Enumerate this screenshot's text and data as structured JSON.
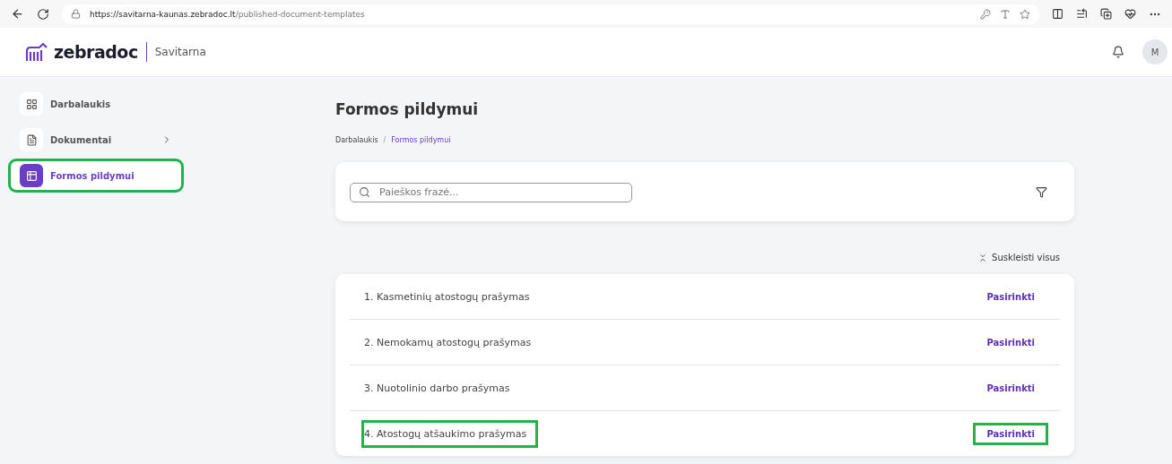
{
  "browser": {
    "url_host": "https://savitarna-kaunas.zebradoc.lt",
    "url_path": "/published-document-templates"
  },
  "header": {
    "brand": "zebradoc",
    "product": "Savitarna",
    "avatar": "M"
  },
  "sidebar": {
    "items": [
      {
        "label": "Darbalaukis",
        "kind": "dashboard",
        "selected": false,
        "highlighted": false,
        "expandable": false
      },
      {
        "label": "Dokumentai",
        "kind": "document",
        "selected": false,
        "highlighted": false,
        "expandable": true
      },
      {
        "label": "Formos pildymui",
        "kind": "form",
        "selected": true,
        "highlighted": true,
        "expandable": false
      }
    ]
  },
  "page": {
    "title": "Formos pildymui",
    "breadcrumb": [
      {
        "label": "Darbalaukis",
        "selected": false
      },
      {
        "label": "Formos pildymui",
        "selected": true
      }
    ],
    "separator": "/"
  },
  "search": {
    "placeholder": "Paieškos frazė..."
  },
  "collapse_all": "Suskleisti visus",
  "templates": [
    {
      "name": "1. Kasmetinių atostogų prašymas",
      "action": "Pasirinkti",
      "highlighted": false
    },
    {
      "name": "2. Nemokamų atostogų prašymas",
      "action": "Pasirinkti",
      "highlighted": false
    },
    {
      "name": "3. Nuotolinio darbo prašymas",
      "action": "Pasirinkti",
      "highlighted": false
    },
    {
      "name": "4. Atostogų atšaukimo prašymas",
      "action": "Pasirinkti",
      "highlighted": true
    }
  ]
}
